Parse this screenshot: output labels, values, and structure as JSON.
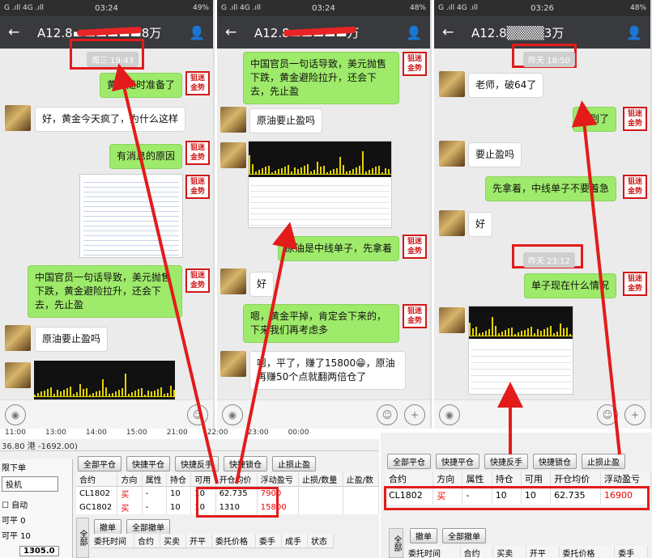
{
  "panels": [
    {
      "status": {
        "left": "G .ıll 4G .ıll",
        "time": "03:24",
        "right": "49%"
      },
      "title": "A12.8▬▬▬▬▬▬8万",
      "timestamp": "周三 19:43",
      "messages": [
        "黄金随时准备了",
        "好，黄金今天疯了，为什么这样",
        "有消息的原因",
        "中国官员一句话导致，美元抛售下跌，黄金避险拉升，还会下去，先止盈",
        "原油要止盈吗"
      ]
    },
    {
      "status": {
        "left": "G .ıll 4G .ıll",
        "time": "03:24",
        "right": "48%"
      },
      "title": "A12.8▬▬▬▬▬万",
      "messages": [
        "中国官员一句话导致，美元抛售下跌，黄金避险拉升，还会下去，先止盈",
        "原油要止盈吗",
        "原油是中线单子，先拿着",
        "好",
        "嗯，黄金平掉，肯定会下来的，下来我们再考虑多",
        "嗯，平了，赚了15800😁，原油再赚50个点就翻两倍仓了"
      ]
    },
    {
      "status": {
        "left": "G .ıll 4G .ıll",
        "time": "03:26",
        "right": "48%"
      },
      "title": "A12.8▒▒▒▒3万",
      "timestamps": [
        "昨天 18:50",
        "昨天 23:12"
      ],
      "messages": [
        "老师，破64了",
        "看到了",
        "要止盈吗",
        "先拿着，中线单子不要着急",
        "好",
        "单子现在什么情况"
      ]
    }
  ],
  "seal_text": "狙迷金势",
  "trade_left": {
    "timeline": [
      "11:00",
      "13:00",
      "14:00",
      "15:00",
      "21:00",
      "22:00",
      "23:00",
      "00:00"
    ],
    "info": "36.80 港 -1692.00)",
    "left_labels": {
      "order_type": "限下单",
      "account": "投机",
      "auto": "自动",
      "open1": "可平 0",
      "open2": "可平 10",
      "price": "1305.0"
    },
    "buttons": [
      "全部平仓",
      "快捷平仓",
      "快捷反手",
      "快捷锁仓",
      "止损止盈"
    ],
    "headers": [
      "合约",
      "方向",
      "属性",
      "持仓",
      "可用",
      "开仓均价",
      "浮动盈亏",
      "止损/数量",
      "止盈/数"
    ],
    "rows": [
      [
        "CL1802",
        "买",
        "-",
        "10",
        "10",
        "62.735",
        "7900"
      ],
      [
        "GC1802",
        "买",
        "-",
        "10",
        "10",
        "1310",
        "15800"
      ]
    ],
    "tabs": [
      "撤单",
      "全部撤单"
    ],
    "vtab": "全部",
    "order_headers": [
      "委托时间",
      "合约",
      "买卖",
      "开平",
      "委托价格",
      "委手",
      "成手",
      "状态"
    ]
  },
  "trade_right": {
    "buttons": [
      "全部平仓",
      "快捷平仓",
      "快捷反手",
      "快捷锁仓",
      "止损止盈"
    ],
    "headers": [
      "合约",
      "方向",
      "属性",
      "持仓",
      "可用",
      "开仓均价",
      "浮动盈亏"
    ],
    "row": [
      "CL1802",
      "买",
      "-",
      "10",
      "10",
      "62.735",
      "16900"
    ],
    "tabs": [
      "撤单",
      "全部撤单"
    ],
    "vtab": "全部",
    "order_headers": [
      "委托时间",
      "合约",
      "买卖",
      "开平",
      "委托价格",
      "委手"
    ]
  },
  "colors": {
    "red": "#e31b1b",
    "bubble_me": "#9eea6a"
  }
}
